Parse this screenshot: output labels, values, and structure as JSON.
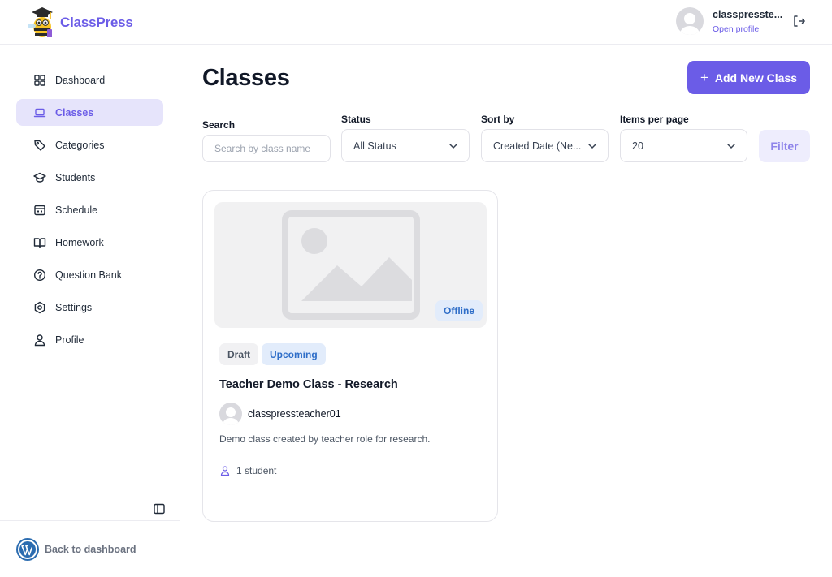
{
  "header": {
    "logo_text": "ClassPress",
    "user_name": "classpresste...",
    "profile_link": "Open profile"
  },
  "sidebar": {
    "items": [
      {
        "label": "Dashboard",
        "icon": "grid-icon"
      },
      {
        "label": "Classes",
        "icon": "laptop-icon",
        "active": true
      },
      {
        "label": "Categories",
        "icon": "tag-icon"
      },
      {
        "label": "Students",
        "icon": "graduation-cap-icon"
      },
      {
        "label": "Schedule",
        "icon": "calendar-icon"
      },
      {
        "label": "Homework",
        "icon": "book-icon"
      },
      {
        "label": "Question Bank",
        "icon": "question-circle-icon"
      },
      {
        "label": "Settings",
        "icon": "gear-icon"
      },
      {
        "label": "Profile",
        "icon": "user-icon"
      }
    ],
    "back_label": "Back to dashboard"
  },
  "main": {
    "title": "Classes",
    "add_button": "Add New Class",
    "filters": {
      "search_label": "Search",
      "search_placeholder": "Search by class name",
      "status_label": "Status",
      "status_value": "All Status",
      "sort_label": "Sort by",
      "sort_value": "Created Date (Ne...",
      "per_page_label": "Items per page",
      "per_page_value": "20",
      "filter_button": "Filter"
    },
    "card": {
      "location_badge": "Offline",
      "status_badges": [
        "Draft",
        "Upcoming"
      ],
      "title": "Teacher Demo Class - Research",
      "teacher": "classpressteacher01",
      "description": "Demo class created by teacher role for research.",
      "students": "1 student"
    }
  },
  "colors": {
    "accent": "#6b5ce7",
    "accent_light": "#e6e4fb",
    "badge_blue_bg": "#e2ecfb",
    "badge_blue_text": "#2f6ec8"
  }
}
